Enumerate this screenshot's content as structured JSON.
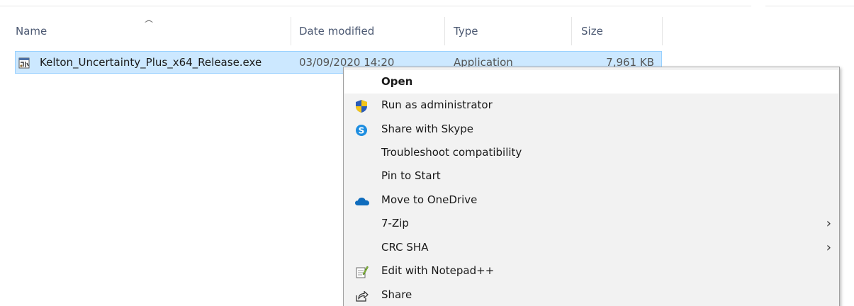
{
  "columns": {
    "name": "Name",
    "date_modified": "Date modified",
    "type": "Type",
    "size": "Size",
    "sort_indicator": "^"
  },
  "file": {
    "name": "Kelton_Uncertainty_Plus_x64_Release.exe",
    "date_modified": "03/09/2020 14:20",
    "type": "Application",
    "size": "7,961 KB",
    "icon": "application-exe-icon"
  },
  "context_menu": {
    "items": [
      {
        "label": "Open",
        "icon": null,
        "bold": true,
        "submenu": false
      },
      {
        "label": "Run as administrator",
        "icon": "uac-shield-icon",
        "bold": false,
        "submenu": false
      },
      {
        "label": "Share with Skype",
        "icon": "skype-icon",
        "bold": false,
        "submenu": false
      },
      {
        "label": "Troubleshoot compatibility",
        "icon": null,
        "bold": false,
        "submenu": false
      },
      {
        "label": "Pin to Start",
        "icon": null,
        "bold": false,
        "submenu": false
      },
      {
        "label": "Move to OneDrive",
        "icon": "onedrive-cloud-icon",
        "bold": false,
        "submenu": false
      },
      {
        "label": "7-Zip",
        "icon": null,
        "bold": false,
        "submenu": true
      },
      {
        "label": "CRC SHA",
        "icon": null,
        "bold": false,
        "submenu": true
      },
      {
        "label": "Edit with Notepad++",
        "icon": "notepadpp-icon",
        "bold": false,
        "submenu": false
      },
      {
        "label": "Share",
        "icon": "share-icon",
        "bold": false,
        "submenu": false
      }
    ],
    "submenu_glyph": "›"
  },
  "colors": {
    "selection_bg": "#cce8ff",
    "selection_border": "#99d1ff",
    "menu_bg": "#f2f2f2",
    "menu_hover": "#ffffff",
    "header_text": "#4d5a73"
  }
}
